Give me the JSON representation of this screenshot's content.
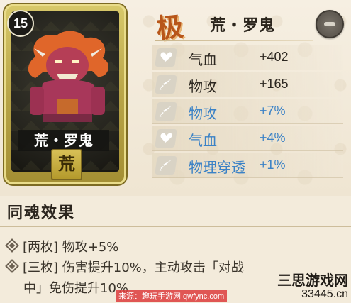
{
  "card": {
    "level": "15",
    "name": "荒・罗鬼",
    "seal": "荒"
  },
  "header": {
    "grade": "极",
    "soul_name": "荒・罗鬼"
  },
  "stats": [
    {
      "icon": "heart-icon",
      "label": "气血",
      "value": "+402",
      "kind": "main"
    },
    {
      "icon": "sword-icon",
      "label": "物攻",
      "value": "+165",
      "kind": "main"
    },
    {
      "icon": "sword-icon",
      "label": "物攻",
      "value": "+7%",
      "kind": "sub"
    },
    {
      "icon": "heart-icon",
      "label": "气血",
      "value": "+4%",
      "kind": "sub"
    },
    {
      "icon": "sword-icon",
      "label": "物理穿透",
      "value": "+1%",
      "kind": "sub"
    }
  ],
  "set_effect": {
    "title": "同魂效果",
    "two_piece": "[两枚] 物攻+5%",
    "three_piece_line1": "[三枚] 伤害提升10%，主动攻击「对战",
    "three_piece_line2": "中」免伤提升10%"
  },
  "watermark": {
    "source": "来源：趣玩手游网 qwfync.com",
    "logo_line1": "三思游戏网",
    "logo_line2": "33445.cn"
  },
  "colors": {
    "main_text": "#2c2720",
    "sub_stat": "#3b82c6",
    "grade": "#b8561a"
  }
}
